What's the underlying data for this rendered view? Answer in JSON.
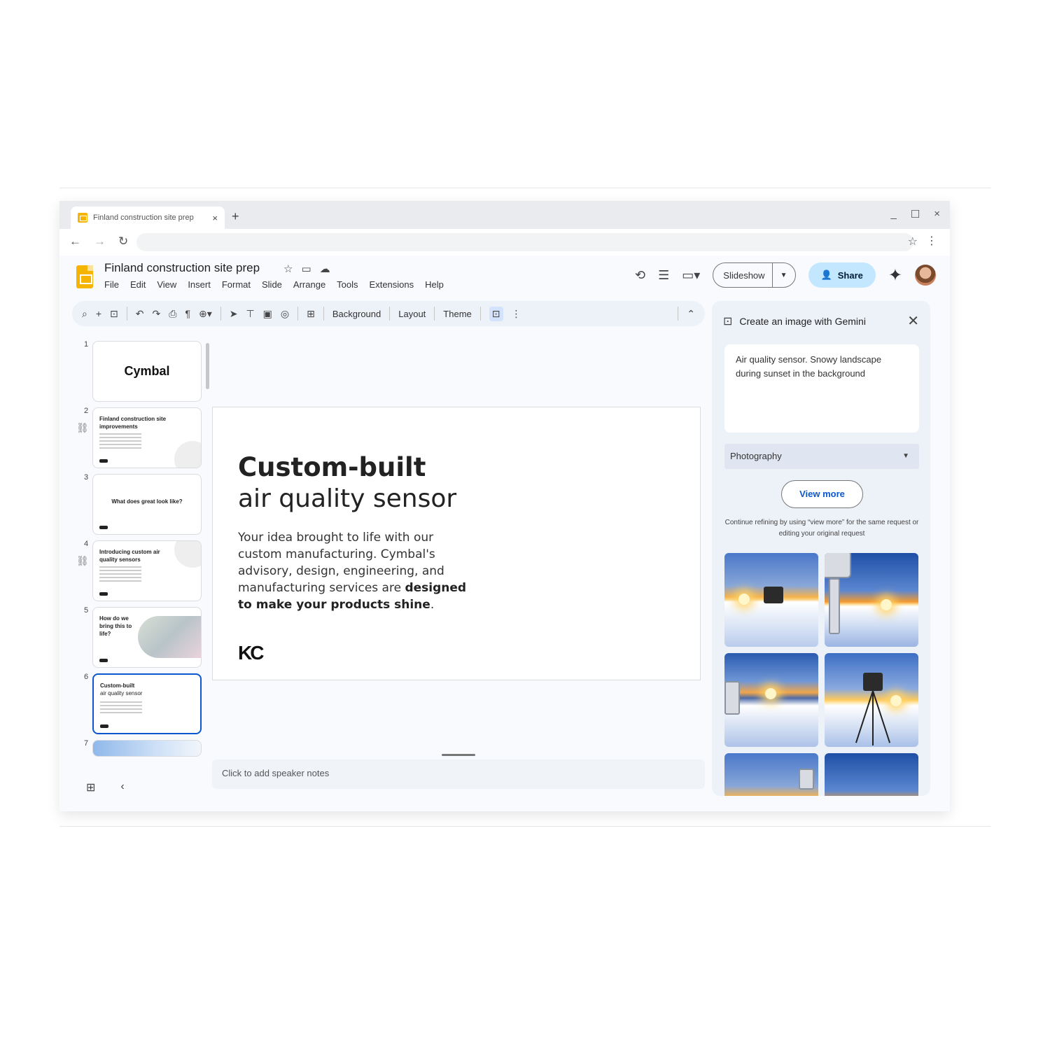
{
  "browser": {
    "tab_title": "Finland construction site prep",
    "tab_close": "×",
    "new_tab": "+",
    "win_minimize": "_",
    "win_maximize": "☐",
    "win_close": "×"
  },
  "app": {
    "doc_title": "Finland construction site prep",
    "menu": [
      "File",
      "Edit",
      "View",
      "Insert",
      "Format",
      "Slide",
      "Arrange",
      "Tools",
      "Extensions",
      "Help"
    ],
    "slideshow_label": "Slideshow",
    "share_label": "Share"
  },
  "toolbar": {
    "background_label": "Background",
    "layout_label": "Layout",
    "theme_label": "Theme"
  },
  "filmstrip": {
    "slides": [
      {
        "num": "1",
        "title": "Cymbal"
      },
      {
        "num": "2",
        "title": "Finland construction site improvements"
      },
      {
        "num": "3",
        "title": "What does great look like?"
      },
      {
        "num": "4",
        "title": "Introducing custom air quality sensors"
      },
      {
        "num": "5",
        "title": "How do we bring this to life?"
      },
      {
        "num": "6",
        "title": "Custom-built",
        "subtitle": "air quality sensor"
      },
      {
        "num": "7",
        "title": ""
      }
    ]
  },
  "slide": {
    "heading_bold": "Custom-built",
    "heading_regular": "air quality sensor",
    "body_plain": "Your idea brought to life with our custom manufacturing. Cymbal's advisory, design, engineering, and manufacturing services are ",
    "body_bold": "designed to make your products shine",
    "body_end": ".",
    "logo_text": "KC"
  },
  "notes": {
    "placeholder": "Click to add speaker notes"
  },
  "gemini": {
    "header": "Create an image with Gemini",
    "prompt": "Air quality sensor. Snowy landscape during sunset in the background",
    "style": "Photography",
    "view_more": "View more",
    "hint": "Continue refining by using “view more” for the same request or editing your original request"
  },
  "colors": {
    "accent_blue": "#0b57d0",
    "share_bg": "#c2e7ff",
    "slides_yellow": "#f4b400"
  }
}
